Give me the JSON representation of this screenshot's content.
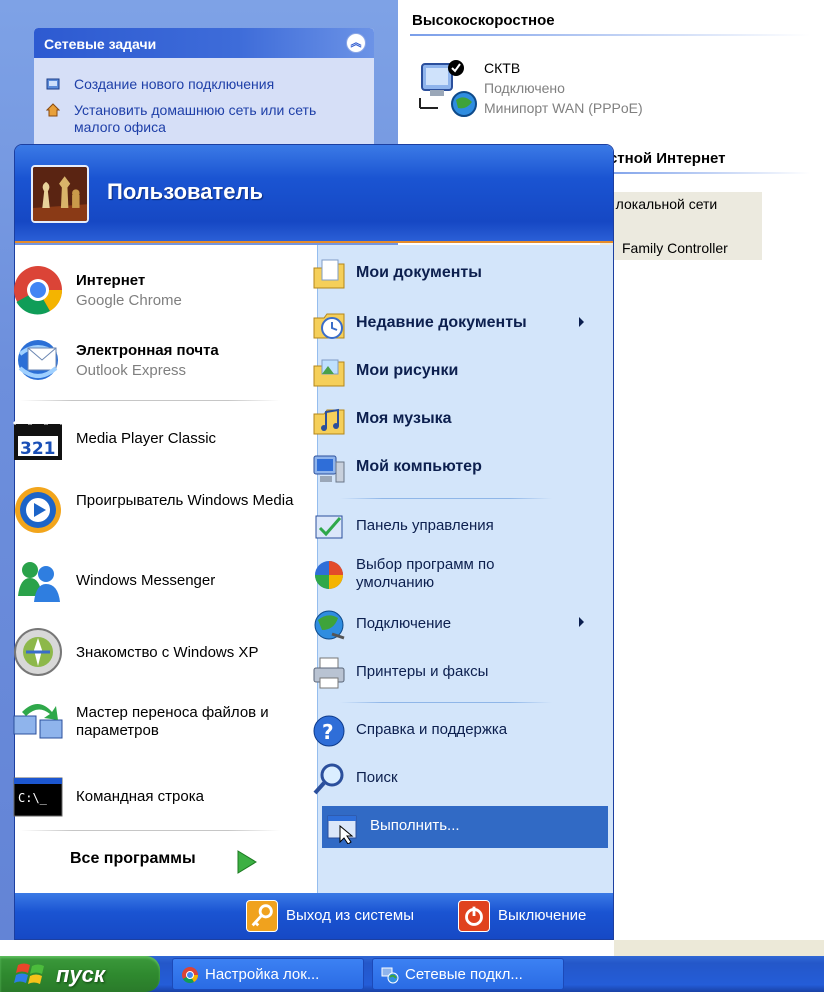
{
  "network_window": {
    "tasks_pane": {
      "title": "Сетевые задачи",
      "items": [
        {
          "label": "Создание нового подключения",
          "icon": "new-connection-icon"
        },
        {
          "label": "Установить домашнюю сеть или сеть малого офиса",
          "icon": "home-network-icon"
        }
      ]
    },
    "section_highspeed": {
      "title": "Высокоскоростное",
      "connection": {
        "name": "СКТВ",
        "status": "Подключено",
        "device": "Минипорт WAN (PPPoE)"
      }
    },
    "section_lan": {
      "title": "остной Интернет",
      "connection": {
        "name": "о локальной сети",
        "device": "Family Controller"
      }
    }
  },
  "start_menu": {
    "user_name": "Пользователь",
    "pinned": [
      {
        "title": "Интернет",
        "subtitle": "Google Chrome",
        "icon": "chrome-icon"
      },
      {
        "title": "Электронная почта",
        "subtitle": "Outlook Express",
        "icon": "outlook-express-icon"
      }
    ],
    "recent": [
      {
        "label": "Media Player Classic",
        "icon": "media-player-classic-icon"
      },
      {
        "label": "Проигрыватель Windows Media",
        "icon": "windows-media-player-icon"
      },
      {
        "label": "Windows Messenger",
        "icon": "windows-messenger-icon"
      },
      {
        "label": "Знакомство с Windows XP",
        "icon": "windows-tour-icon"
      },
      {
        "label": "Мастер переноса файлов и параметров",
        "icon": "transfer-wizard-icon"
      },
      {
        "label": "Командная строка",
        "icon": "command-prompt-icon"
      }
    ],
    "all_programs": "Все программы",
    "places": [
      {
        "label": "Мои документы",
        "icon": "my-documents-icon"
      },
      {
        "label": "Недавние документы",
        "icon": "recent-documents-icon"
      },
      {
        "label": "Мои рисунки",
        "icon": "my-pictures-icon"
      },
      {
        "label": "Моя музыка",
        "icon": "my-music-icon"
      },
      {
        "label": "Мой компьютер",
        "icon": "my-computer-icon"
      }
    ],
    "system": [
      {
        "label": "Панель управления",
        "icon": "control-panel-icon"
      },
      {
        "label": "Выбор программ по умолчанию",
        "icon": "default-programs-icon"
      },
      {
        "label": "Подключение",
        "icon": "connect-to-icon"
      },
      {
        "label": "Принтеры и факсы",
        "icon": "printers-faxes-icon"
      }
    ],
    "help": [
      {
        "label": "Справка и поддержка",
        "icon": "help-icon"
      },
      {
        "label": "Поиск",
        "icon": "search-icon"
      },
      {
        "label": "Выполнить...",
        "icon": "run-icon",
        "highlighted": true
      }
    ],
    "footer": {
      "logoff": "Выход из системы",
      "shutdown": "Выключение"
    }
  },
  "taskbar": {
    "start_label": "пуск",
    "buttons": [
      {
        "label": "Настройка лок...",
        "icon": "chrome-icon"
      },
      {
        "label": "Сетевые подкл...",
        "icon": "network-connections-icon"
      }
    ]
  },
  "colors": {
    "menu_blue": "#1a54d2",
    "menu_right_bg": "#d3e5fa",
    "selection": "#316ac5",
    "start_green": "#2f8a2f"
  }
}
